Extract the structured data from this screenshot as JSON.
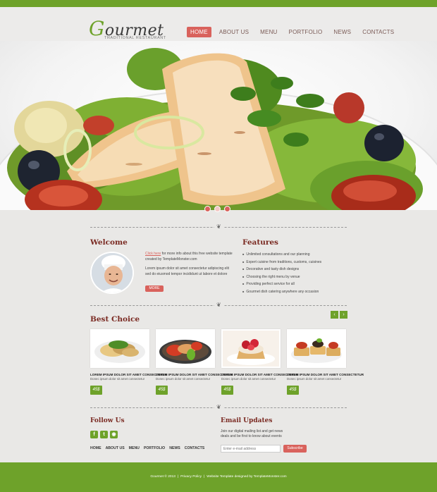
{
  "colors": {
    "brand_green": "#6ea22a",
    "accent_red": "#d9625c",
    "heading_red": "#7a2a22",
    "background": "#e9e8e6"
  },
  "logo": {
    "first_letter": "G",
    "rest": "ourmet",
    "tagline": "TRADITIONAL RESTAURANT"
  },
  "nav": [
    "HOME",
    "ABOUT US",
    "MENU",
    "PORTFOLIO",
    "NEWS",
    "CONTACTS"
  ],
  "slider": {
    "active_index": 1,
    "count": 3
  },
  "welcome": {
    "heading": "Welcome",
    "link_text": "Click here",
    "text_rest": "for more info about this free website template created by TemplateMonster.com",
    "text2": "Lorem ipsum dolor sit amet consectetur adipiscing elit sed do eiusmod tempor incididunt ut labore et dolore",
    "more_label": "MORE"
  },
  "features": {
    "heading": "Features",
    "items": [
      "Unlimited consultations and our planning",
      "Expert cuisine from traditions, customs, cuisines",
      "Decorative and tasty dish designs",
      "Choosing the right menu by venue",
      "Providing perfect service for all",
      "Gourmet dish catering anywhere any occasion"
    ]
  },
  "best_choice": {
    "heading": "Best Choice",
    "items": [
      {
        "title": "LOREM IPSUM DOLOR SIT AMET CONSECTETUR",
        "sub": "Donec ipsum dolor sit amet consectetur",
        "price": "45$"
      },
      {
        "title": "LOREM IPSUM DOLOR SIT AMET CONSECTETUR",
        "sub": "Donec ipsum dolor sit amet consectetur",
        "price": "45$"
      },
      {
        "title": "LOREM IPSUM DOLOR SIT AMET CONSECTETUR",
        "sub": "Donec ipsum dolor sit amet consectetur",
        "price": "45$"
      },
      {
        "title": "LOREM IPSUM DOLOR SIT AMET CONSECTETUR",
        "sub": "Donec ipsum dolor sit amet consectetur",
        "price": "45$"
      }
    ]
  },
  "follow": {
    "heading": "Follow Us",
    "icons": [
      "facebook-icon",
      "twitter-icon",
      "rss-icon"
    ]
  },
  "footer_nav": [
    "HOME",
    "ABOUT US",
    "MENU",
    "PORTFOLIO",
    "NEWS",
    "CONTACTS"
  ],
  "email": {
    "heading": "Email Updates",
    "text": "Join our digital mailing list and get news deals and be first to know about events",
    "placeholder": "Enter e-mail address",
    "button": "Subscribe"
  },
  "footer": {
    "copyright": "Gourmet © 2013",
    "privacy": "Privacy Policy",
    "credit": "Website Template designed by TemplateMonster.com"
  }
}
